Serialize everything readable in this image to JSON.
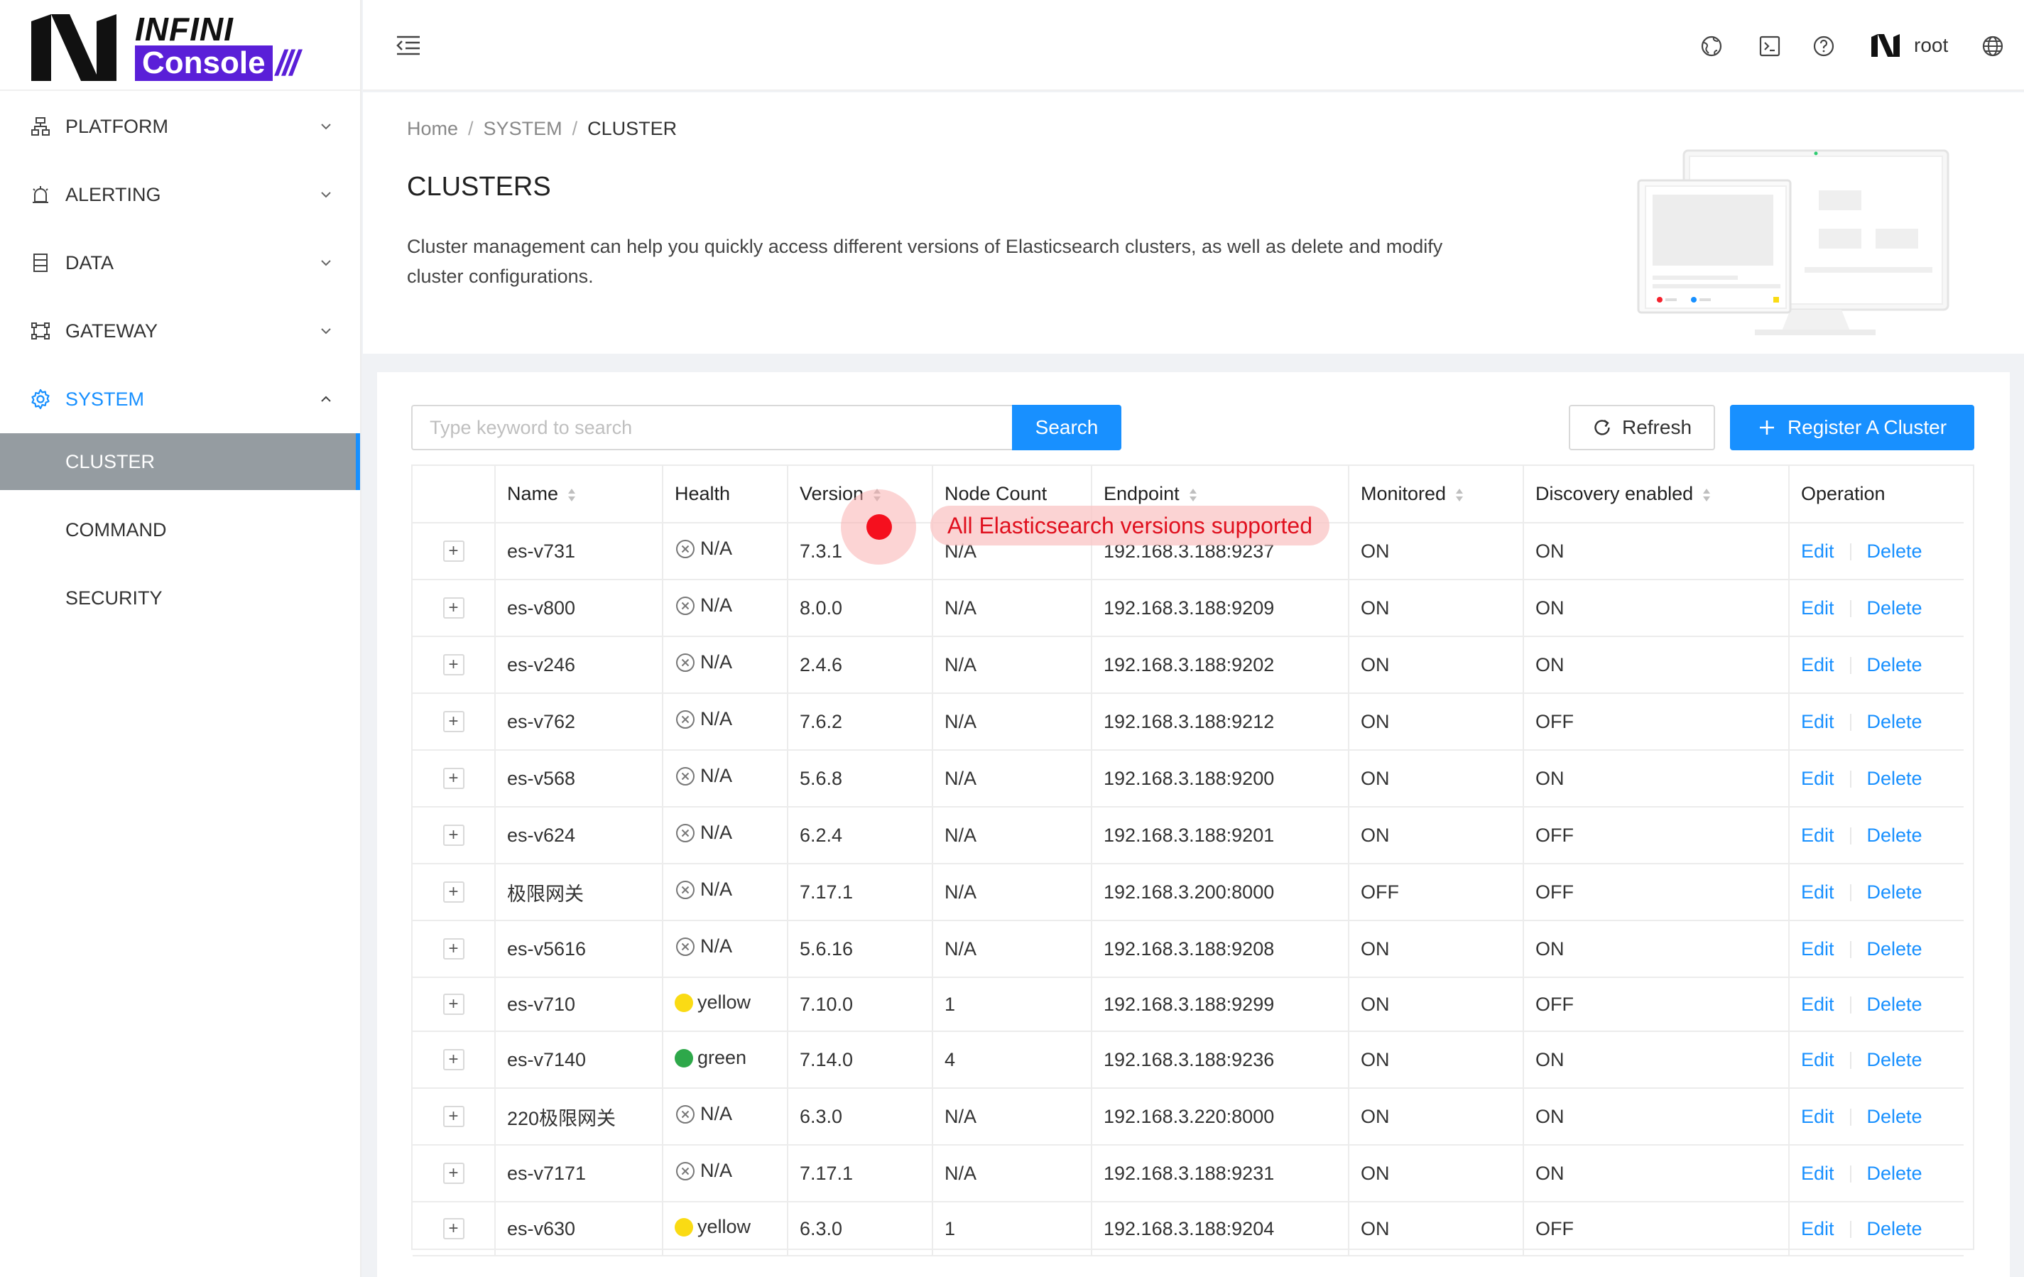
{
  "app": {
    "logo_top": "INFINI",
    "logo_bottom": "Console",
    "logo_slashes": "///"
  },
  "sidebar": {
    "items": [
      {
        "label": "PLATFORM",
        "icon": "cluster-tree-icon",
        "expanded": false
      },
      {
        "label": "ALERTING",
        "icon": "alarm-icon",
        "expanded": false
      },
      {
        "label": "DATA",
        "icon": "database-icon",
        "expanded": false
      },
      {
        "label": "GATEWAY",
        "icon": "gateway-icon",
        "expanded": false
      },
      {
        "label": "SYSTEM",
        "icon": "gear-icon",
        "expanded": true
      }
    ],
    "system_children": [
      "CLUSTER",
      "COMMAND",
      "SECURITY"
    ],
    "selected": "CLUSTER"
  },
  "header": {
    "icons": [
      "collapse-menu-icon",
      "globe-monitor-icon",
      "terminal-icon",
      "help-icon",
      "user-logo-icon",
      "language-icon"
    ],
    "username": "root"
  },
  "page": {
    "breadcrumb": [
      "Home",
      "SYSTEM",
      "CLUSTER"
    ],
    "title": "CLUSTERS",
    "description": "Cluster management can help you quickly access different versions of Elasticsearch clusters, as well as delete and modify cluster configurations."
  },
  "toolbar": {
    "search_placeholder": "Type keyword to search",
    "search_label": "Search",
    "refresh_label": "Refresh",
    "register_label": "Register A Cluster"
  },
  "table": {
    "columns": [
      "",
      "Name",
      "Health",
      "Version",
      "Node Count",
      "Endpoint",
      "Monitored",
      "Discovery enabled",
      "Operation"
    ],
    "sortable": [
      false,
      true,
      false,
      true,
      false,
      true,
      true,
      true,
      false
    ],
    "rows": [
      {
        "name": "es-v731",
        "health": "N/A",
        "health_state": "unknown",
        "version": "7.3.1",
        "node_count": "N/A",
        "endpoint": "192.168.3.188:9237",
        "monitored": "ON",
        "discovery": "ON"
      },
      {
        "name": "es-v800",
        "health": "N/A",
        "health_state": "unknown",
        "version": "8.0.0",
        "node_count": "N/A",
        "endpoint": "192.168.3.188:9209",
        "monitored": "ON",
        "discovery": "ON"
      },
      {
        "name": "es-v246",
        "health": "N/A",
        "health_state": "unknown",
        "version": "2.4.6",
        "node_count": "N/A",
        "endpoint": "192.168.3.188:9202",
        "monitored": "ON",
        "discovery": "ON"
      },
      {
        "name": "es-v762",
        "health": "N/A",
        "health_state": "unknown",
        "version": "7.6.2",
        "node_count": "N/A",
        "endpoint": "192.168.3.188:9212",
        "monitored": "ON",
        "discovery": "OFF"
      },
      {
        "name": "es-v568",
        "health": "N/A",
        "health_state": "unknown",
        "version": "5.6.8",
        "node_count": "N/A",
        "endpoint": "192.168.3.188:9200",
        "monitored": "ON",
        "discovery": "ON"
      },
      {
        "name": "es-v624",
        "health": "N/A",
        "health_state": "unknown",
        "version": "6.2.4",
        "node_count": "N/A",
        "endpoint": "192.168.3.188:9201",
        "monitored": "ON",
        "discovery": "OFF"
      },
      {
        "name": "极限网关",
        "health": "N/A",
        "health_state": "unknown",
        "version": "7.17.1",
        "node_count": "N/A",
        "endpoint": "192.168.3.200:8000",
        "monitored": "OFF",
        "discovery": "OFF"
      },
      {
        "name": "es-v5616",
        "health": "N/A",
        "health_state": "unknown",
        "version": "5.6.16",
        "node_count": "N/A",
        "endpoint": "192.168.3.188:9208",
        "monitored": "ON",
        "discovery": "ON"
      },
      {
        "name": "es-v710",
        "health": "yellow",
        "health_state": "yellow",
        "version": "7.10.0",
        "node_count": "1",
        "endpoint": "192.168.3.188:9299",
        "monitored": "ON",
        "discovery": "OFF"
      },
      {
        "name": "es-v7140",
        "health": "green",
        "health_state": "green",
        "version": "7.14.0",
        "node_count": "4",
        "endpoint": "192.168.3.188:9236",
        "monitored": "ON",
        "discovery": "ON"
      },
      {
        "name": "220极限网关",
        "health": "N/A",
        "health_state": "unknown",
        "version": "6.3.0",
        "node_count": "N/A",
        "endpoint": "192.168.3.220:8000",
        "monitored": "ON",
        "discovery": "ON"
      },
      {
        "name": "es-v7171",
        "health": "N/A",
        "health_state": "unknown",
        "version": "7.17.1",
        "node_count": "N/A",
        "endpoint": "192.168.3.188:9231",
        "monitored": "ON",
        "discovery": "ON"
      },
      {
        "name": "es-v630",
        "health": "yellow",
        "health_state": "yellow",
        "version": "6.3.0",
        "node_count": "1",
        "endpoint": "192.168.3.188:9204",
        "monitored": "ON",
        "discovery": "OFF"
      }
    ],
    "edit_label": "Edit",
    "delete_label": "Delete"
  },
  "tooltip": {
    "text": "All Elasticsearch versions supported"
  },
  "colors": {
    "primary": "#1890ff",
    "brand": "#5a1fd8",
    "yellow": "#fadb14",
    "green": "#2ea84a",
    "selected_bg": "#959ca1",
    "tooltip_dot": "#f5101e"
  }
}
